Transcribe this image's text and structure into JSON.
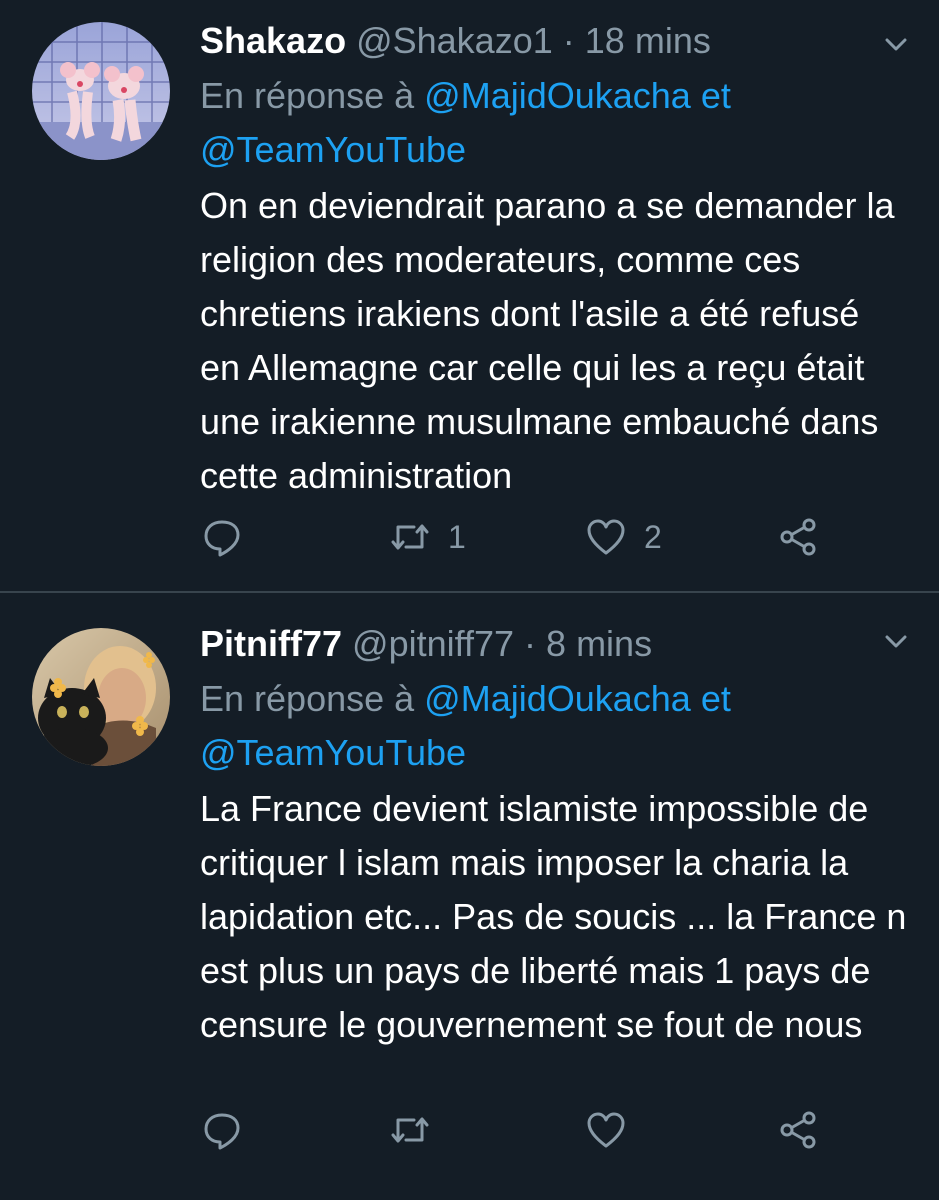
{
  "tweets": [
    {
      "display_name": "Shakazo",
      "handle": "@Shakazo1",
      "separator": "·",
      "time": "18 mins",
      "reply_prefix": "En réponse à",
      "mention_1": "@MajidOukacha",
      "mention_joiner": "et",
      "mention_2": "@TeamYouTube",
      "text": "On en deviendrait parano a se demander la religion des moderateurs, comme ces chretiens irakiens dont l'asile a été refusé en Allemagne car celle qui les a reçu était une irakienne musulmane embauché dans cette administration",
      "retweets": "1",
      "likes": "2",
      "avatar_icon": "cartoon-mice-avatar"
    },
    {
      "display_name": "Pitniff77",
      "handle": "@pitniff77",
      "separator": "·",
      "time": "8 mins",
      "reply_prefix": "En réponse à",
      "mention_1": "@MajidOukacha",
      "mention_joiner": "et",
      "mention_2": "@TeamYouTube",
      "text": "La France devient islamiste impossible de critiquer l islam mais imposer la charia la lapidation etc... Pas de soucis ... la France n est plus un pays de liberté  mais 1 pays de censure le gouvernement se fout de nous",
      "retweets": "",
      "likes": "",
      "avatar_icon": "woman-with-cat-avatar"
    }
  ],
  "colors": {
    "background": "#141d26",
    "text": "#ffffff",
    "secondary": "#8899a6",
    "link": "#1da1f2",
    "divider": "#38444d"
  }
}
